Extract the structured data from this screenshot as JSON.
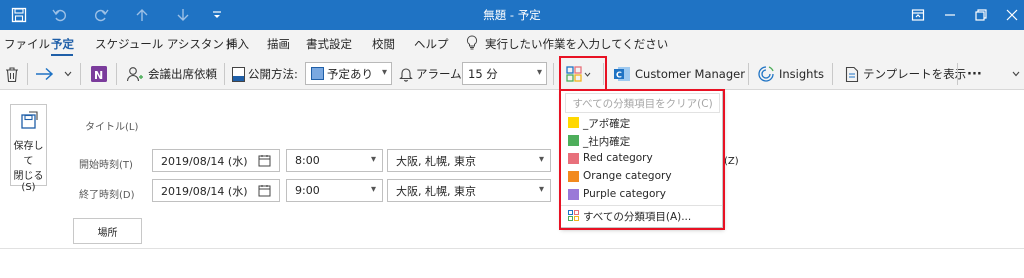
{
  "titlebar": {
    "title": "無題 - 予定",
    "icons": [
      "save-icon",
      "undo-icon",
      "redo-icon",
      "up-arrow-icon",
      "down-arrow-icon",
      "customize-icon"
    ],
    "controls": [
      "ribbon-display-icon",
      "minimize-icon",
      "restore-icon",
      "close-icon"
    ]
  },
  "menu": {
    "items": [
      "ファイル",
      "予定",
      "スケジュール アシスタント",
      "挿入",
      "描画",
      "書式設定",
      "校閲",
      "ヘルプ"
    ],
    "active": "予定",
    "tell_me": "実行したい作業を入力してください"
  },
  "ribbon": {
    "attendance_request": "会議出席依頼",
    "show_as_label": "公開方法:",
    "show_as_value": "予定あり",
    "reminder_label": "アラーム:",
    "reminder_value": "15 分",
    "customer_manager": "Customer Manager",
    "insights": "Insights",
    "show_template": "テンプレートを表示",
    "more": "···"
  },
  "form": {
    "save_close": [
      "保存して",
      "閉じる",
      "(S)"
    ],
    "title_label": "タイトル(L)",
    "start_label": "開始時刻(T)",
    "end_label": "終了時刻(D)",
    "start_date": "2019/08/14 (水)",
    "start_time": "8:00",
    "start_timezone": "大阪, 札幌, 東京",
    "end_date": "2019/08/14 (水)",
    "end_time": "9:00",
    "end_timezone": "大阪, 札幌, 東京",
    "location_button": "場所",
    "timezone_suffix": "(Z)"
  },
  "categorize_menu": {
    "clear_all": "すべての分類項目をクリア(C)",
    "items": [
      {
        "label": "_アポ確定",
        "color": "#ffd800"
      },
      {
        "label": "_社内確定",
        "color": "#4eae5b"
      },
      {
        "label": "Red category",
        "color": "#e8707b"
      },
      {
        "label": "Orange category",
        "color": "#f28a1e"
      },
      {
        "label": "Purple category",
        "color": "#9a79d8"
      }
    ],
    "all_categories": "すべての分類項目(A)..."
  },
  "colors": {
    "titlebar": "#1f73c4",
    "accent": "#1f5fa8",
    "highlight": "#e81123"
  }
}
